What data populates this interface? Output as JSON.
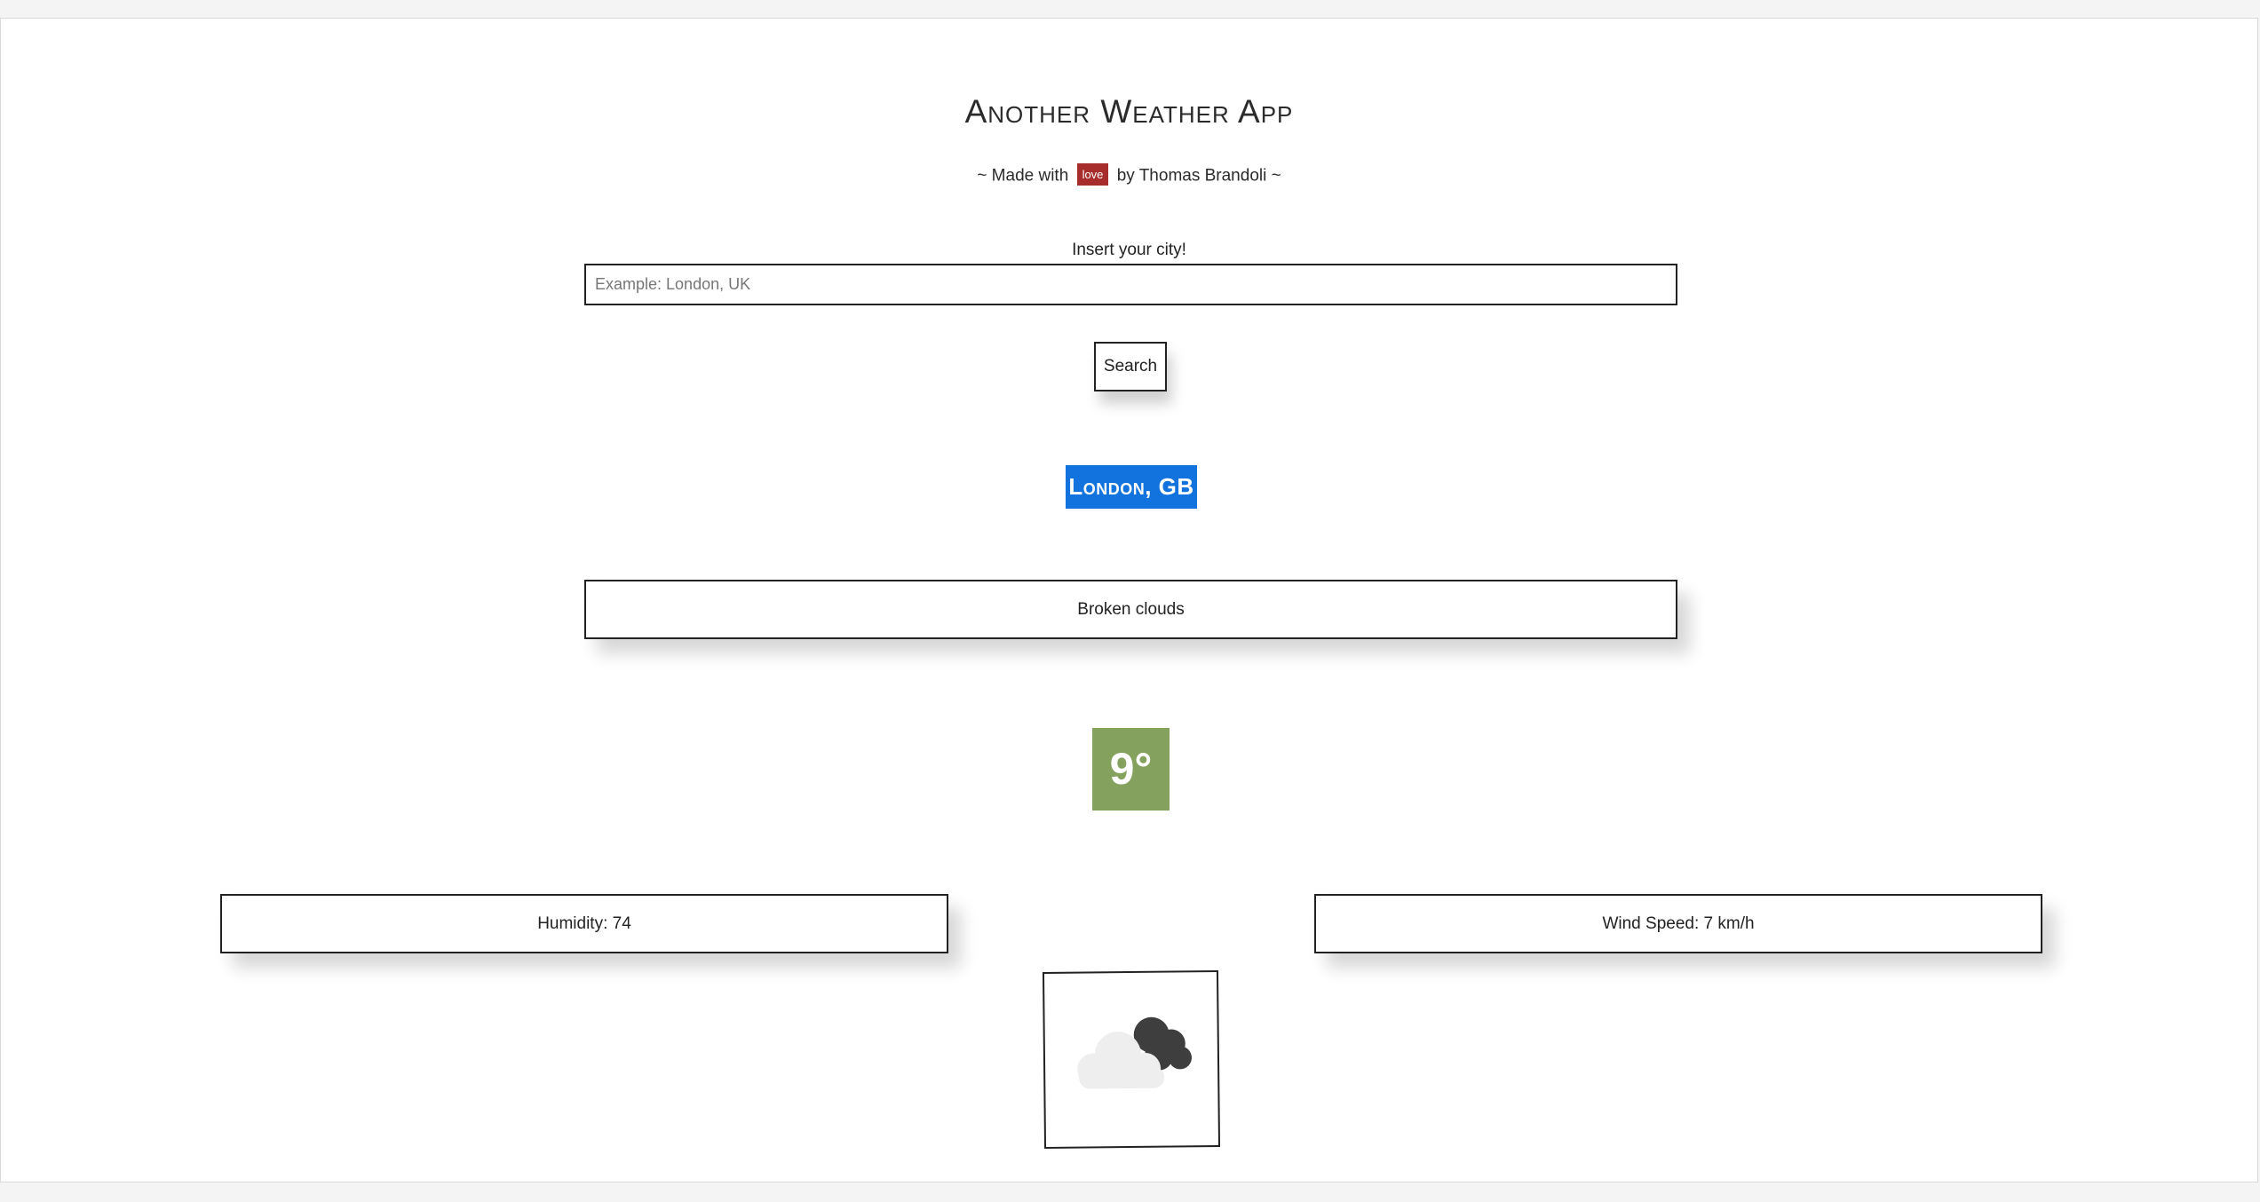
{
  "header": {
    "title": "Another Weather App",
    "subtitle_prefix": "~ Made with",
    "love_badge": "love",
    "subtitle_suffix": "by Thomas Brandoli ~"
  },
  "search": {
    "label": "Insert your city!",
    "placeholder": "Example: London, UK",
    "value": "",
    "button_label": "Search"
  },
  "weather": {
    "city": "London, GB",
    "description": "Broken clouds",
    "temperature": "9°",
    "humidity": "Humidity: 74",
    "wind_speed": "Wind Speed: 7 km/h",
    "icon": "broken-clouds-icon"
  },
  "colors": {
    "city_badge": "#1273de",
    "temperature_badge": "#84a25e",
    "love_badge": "#a72c2c"
  }
}
